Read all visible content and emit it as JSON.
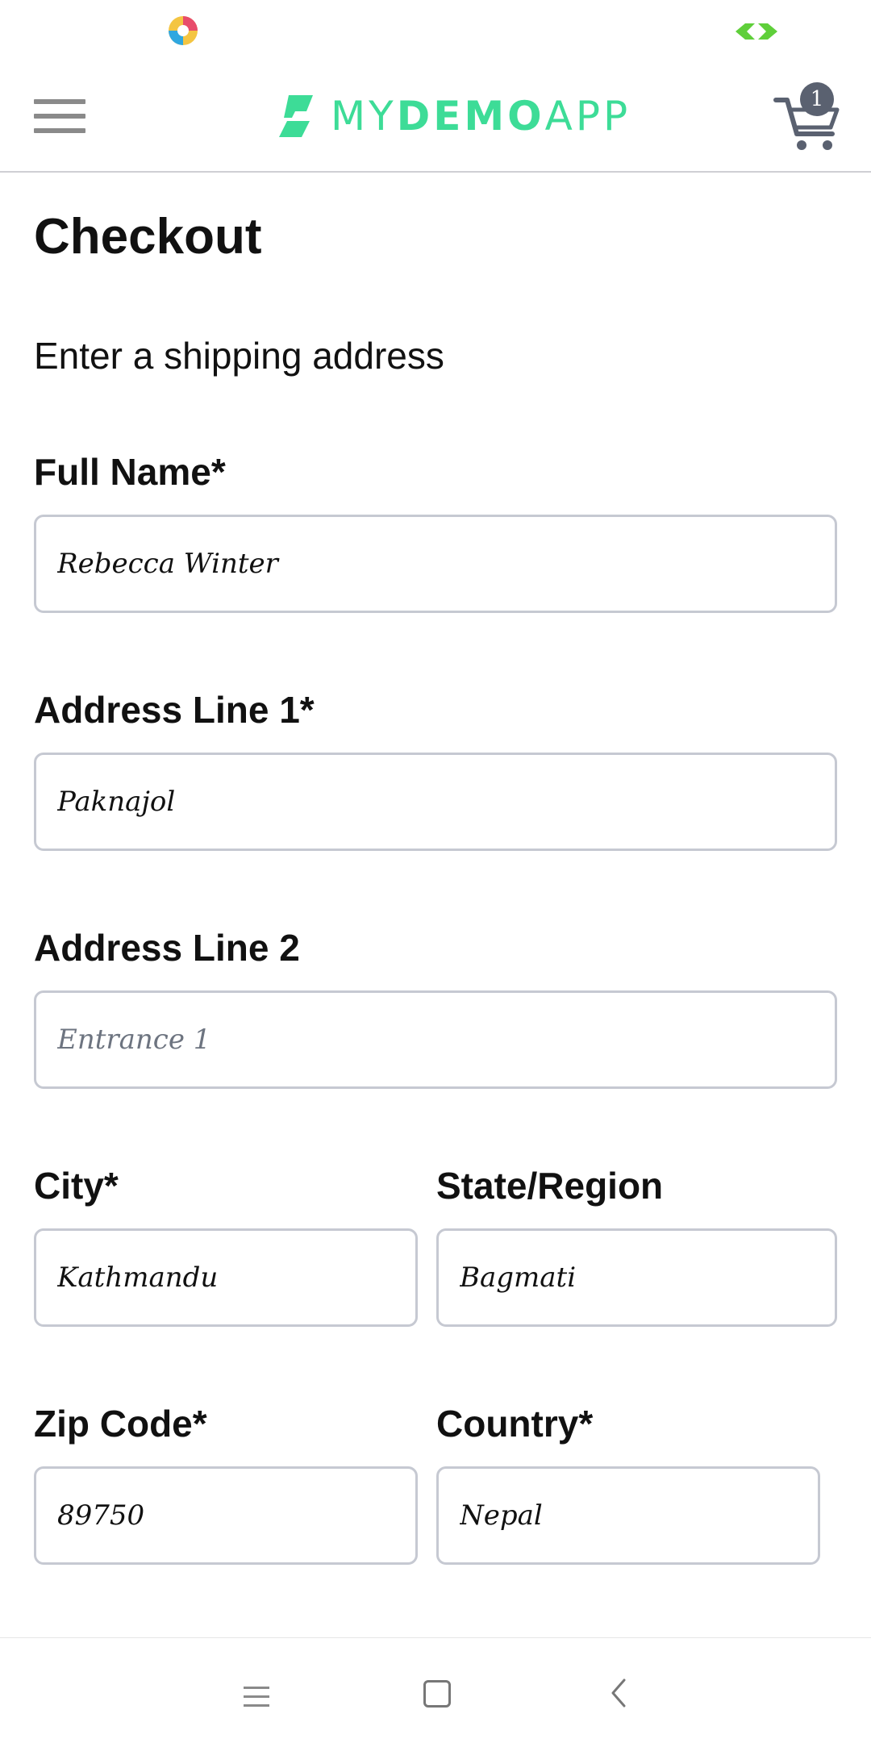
{
  "header": {
    "logo_text_light1": "MY",
    "logo_text_bold": "DEMO",
    "logo_text_light2": "APP",
    "cart_count": "1",
    "brand_color": "#3ddc97"
  },
  "page": {
    "title": "Checkout",
    "section_title": "Enter a shipping address"
  },
  "form": {
    "full_name": {
      "label": "Full Name*",
      "value": "Rebecca Winter"
    },
    "address1": {
      "label": "Address Line 1*",
      "value": "Paknajol"
    },
    "address2": {
      "label": "Address Line 2",
      "value": "",
      "placeholder": "Entrance 1"
    },
    "city": {
      "label": "City*",
      "value": "Kathmandu"
    },
    "state": {
      "label": "State/Region",
      "value": "Bagmati"
    },
    "zip": {
      "label": "Zip Code*",
      "value": "89750"
    },
    "country": {
      "label": "Country*",
      "value": "Nepal"
    }
  },
  "icons": {
    "menu": "hamburger-menu-icon",
    "cart": "shopping-cart-icon",
    "nav_menu": "recent-apps-icon",
    "nav_home": "home-icon",
    "nav_back": "back-icon"
  }
}
